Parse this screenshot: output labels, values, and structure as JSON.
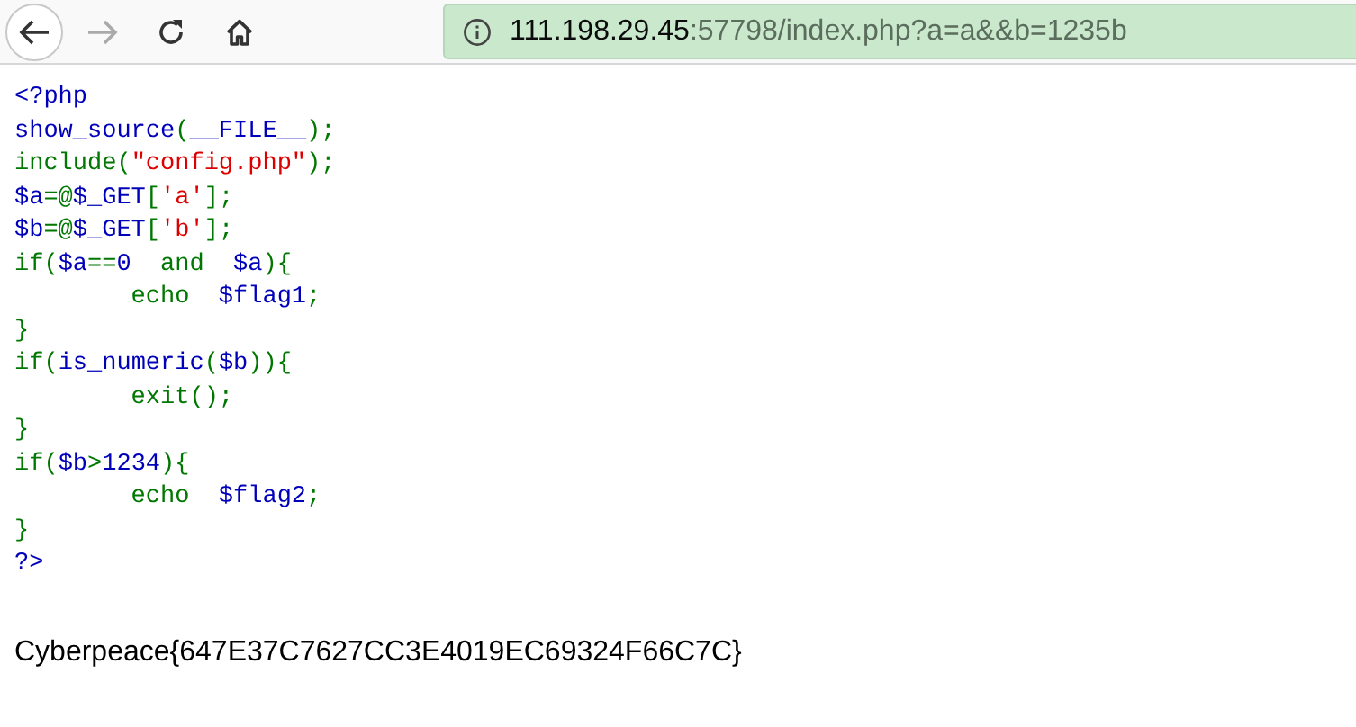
{
  "toolbar": {
    "url_host": "111.198.29.45",
    "url_rest": ":57798/index.php?a=a&&b=1235b"
  },
  "code_lines": [
    {
      "tokens": [
        {
          "kind": "default",
          "text": "<?php"
        }
      ]
    },
    {
      "tokens": [
        {
          "kind": "default",
          "text": "show_source"
        },
        {
          "kind": "keyword",
          "text": "("
        },
        {
          "kind": "default",
          "text": "__FILE__"
        },
        {
          "kind": "keyword",
          "text": ");"
        }
      ]
    },
    {
      "tokens": [
        {
          "kind": "keyword",
          "text": "include("
        },
        {
          "kind": "string",
          "text": "\"config.php\""
        },
        {
          "kind": "keyword",
          "text": ");"
        }
      ]
    },
    {
      "tokens": [
        {
          "kind": "default",
          "text": "$a"
        },
        {
          "kind": "keyword",
          "text": "=@"
        },
        {
          "kind": "default",
          "text": "$_GET"
        },
        {
          "kind": "keyword",
          "text": "["
        },
        {
          "kind": "string",
          "text": "'a'"
        },
        {
          "kind": "keyword",
          "text": "];"
        }
      ]
    },
    {
      "tokens": [
        {
          "kind": "default",
          "text": "$b"
        },
        {
          "kind": "keyword",
          "text": "=@"
        },
        {
          "kind": "default",
          "text": "$_GET"
        },
        {
          "kind": "keyword",
          "text": "["
        },
        {
          "kind": "string",
          "text": "'b'"
        },
        {
          "kind": "keyword",
          "text": "];"
        }
      ]
    },
    {
      "tokens": [
        {
          "kind": "keyword",
          "text": "if("
        },
        {
          "kind": "default",
          "text": "$a"
        },
        {
          "kind": "keyword",
          "text": "=="
        },
        {
          "kind": "default",
          "text": "0  "
        },
        {
          "kind": "keyword",
          "text": "and  "
        },
        {
          "kind": "default",
          "text": "$a"
        },
        {
          "kind": "keyword",
          "text": "){"
        }
      ]
    },
    {
      "tokens": [
        {
          "kind": "keyword",
          "text": "        echo  "
        },
        {
          "kind": "default",
          "text": "$flag1"
        },
        {
          "kind": "keyword",
          "text": ";"
        }
      ]
    },
    {
      "tokens": [
        {
          "kind": "keyword",
          "text": "}"
        }
      ]
    },
    {
      "tokens": [
        {
          "kind": "keyword",
          "text": "if("
        },
        {
          "kind": "default",
          "text": "is_numeric"
        },
        {
          "kind": "keyword",
          "text": "("
        },
        {
          "kind": "default",
          "text": "$b"
        },
        {
          "kind": "keyword",
          "text": ")){"
        }
      ]
    },
    {
      "tokens": [
        {
          "kind": "keyword",
          "text": "        exit();"
        }
      ]
    },
    {
      "tokens": [
        {
          "kind": "keyword",
          "text": "}"
        }
      ]
    },
    {
      "tokens": [
        {
          "kind": "keyword",
          "text": "if("
        },
        {
          "kind": "default",
          "text": "$b"
        },
        {
          "kind": "keyword",
          "text": ">"
        },
        {
          "kind": "default",
          "text": "1234"
        },
        {
          "kind": "keyword",
          "text": "){"
        }
      ]
    },
    {
      "tokens": [
        {
          "kind": "keyword",
          "text": "        echo  "
        },
        {
          "kind": "default",
          "text": "$flag2"
        },
        {
          "kind": "keyword",
          "text": ";"
        }
      ]
    },
    {
      "tokens": [
        {
          "kind": "keyword",
          "text": "}"
        }
      ]
    },
    {
      "tokens": [
        {
          "kind": "default",
          "text": "?>"
        }
      ]
    }
  ],
  "output": "Cyberpeace{647E37C7627CC3E4019EC69324F66C7C}"
}
